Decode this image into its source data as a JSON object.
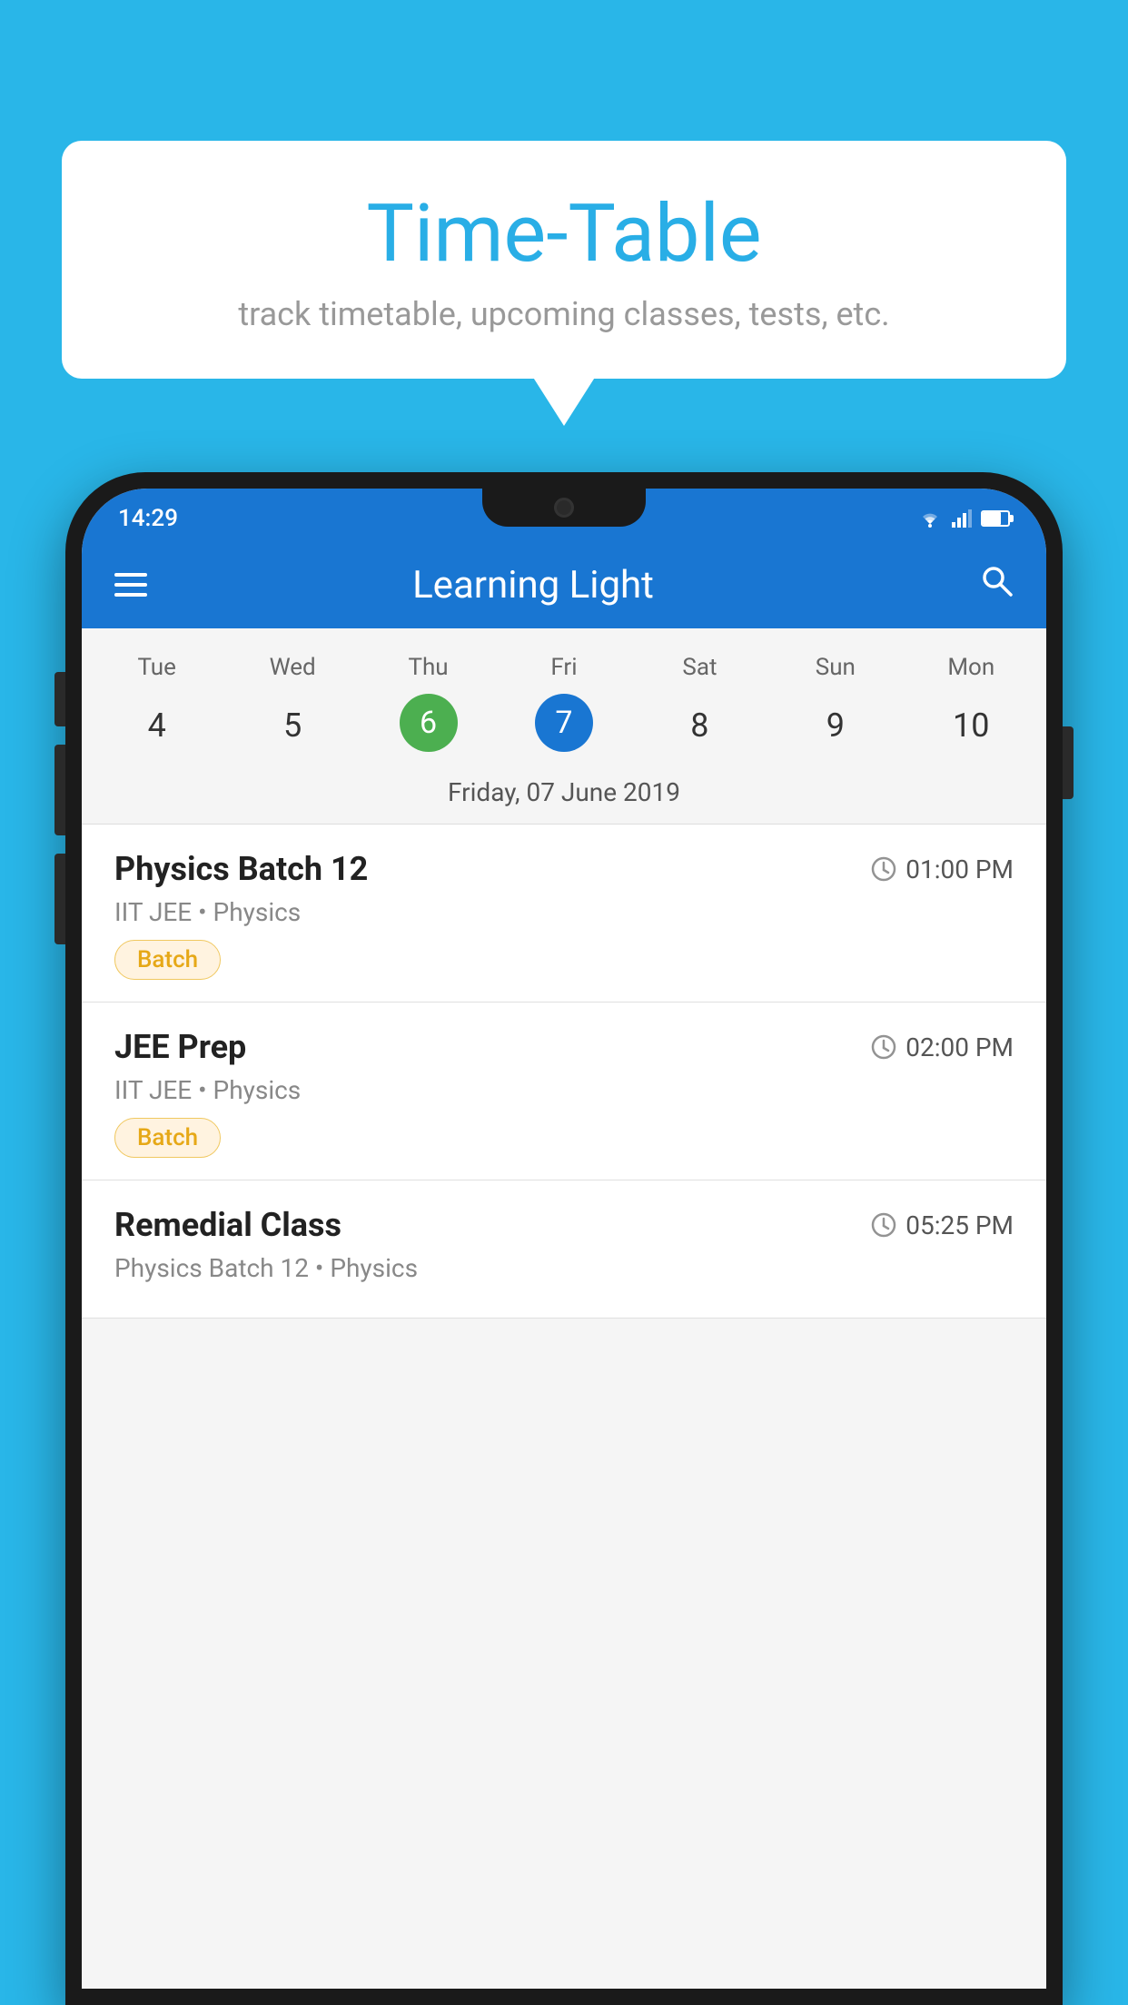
{
  "background_color": "#29b6e8",
  "speech_bubble": {
    "title": "Time-Table",
    "subtitle": "track timetable, upcoming classes, tests, etc."
  },
  "status_bar": {
    "time": "14:29"
  },
  "app_bar": {
    "title": "Learning Light"
  },
  "calendar": {
    "selected_date_label": "Friday, 07 June 2019",
    "days": [
      {
        "name": "Tue",
        "number": "4",
        "state": "normal"
      },
      {
        "name": "Wed",
        "number": "5",
        "state": "normal"
      },
      {
        "name": "Thu",
        "number": "6",
        "state": "today"
      },
      {
        "name": "Fri",
        "number": "7",
        "state": "selected"
      },
      {
        "name": "Sat",
        "number": "8",
        "state": "normal"
      },
      {
        "name": "Sun",
        "number": "9",
        "state": "normal"
      },
      {
        "name": "Mon",
        "number": "10",
        "state": "normal"
      }
    ]
  },
  "schedule": [
    {
      "title": "Physics Batch 12",
      "time": "01:00 PM",
      "subtitle": "IIT JEE • Physics",
      "badge": "Batch"
    },
    {
      "title": "JEE Prep",
      "time": "02:00 PM",
      "subtitle": "IIT JEE • Physics",
      "badge": "Batch"
    },
    {
      "title": "Remedial Class",
      "time": "05:25 PM",
      "subtitle": "Physics Batch 12 • Physics",
      "badge": null
    }
  ],
  "icons": {
    "hamburger": "menu-icon",
    "search": "search-icon",
    "clock": "clock-icon"
  }
}
